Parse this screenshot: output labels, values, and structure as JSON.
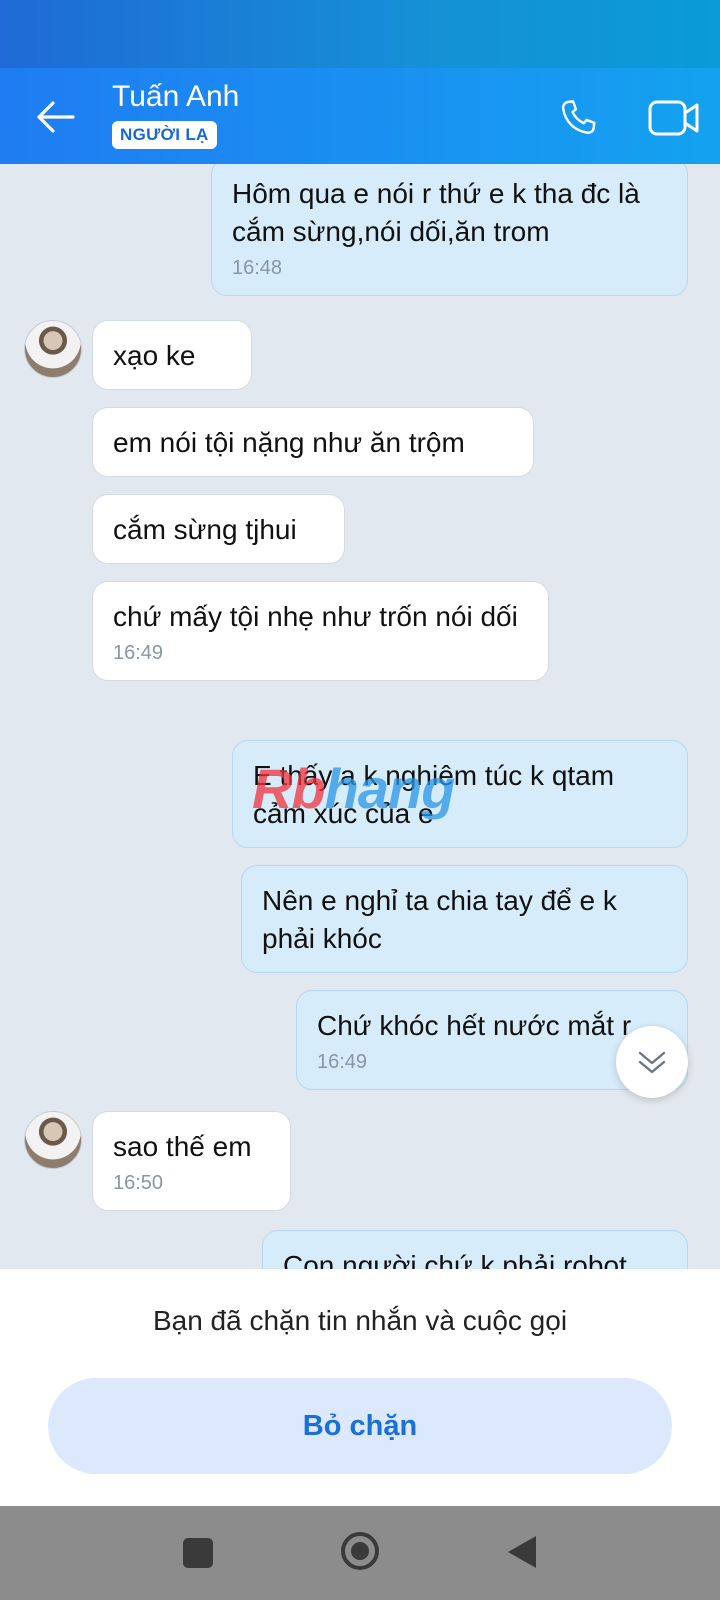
{
  "header": {
    "contact_name": "Tuấn Anh",
    "badge": "NGƯỜI LẠ"
  },
  "messages": [
    {
      "dir": "out",
      "text": "Hôm qua e nói r thứ e k tha đc là cắm sừng,nói dối,ăn trom",
      "time": "16:48"
    },
    {
      "dir": "in",
      "text": "xạo ke",
      "time": ""
    },
    {
      "dir": "in",
      "text": "em nói tội nặng như ăn trộm",
      "time": ""
    },
    {
      "dir": "in",
      "text": "cắm sừng tjhui",
      "time": ""
    },
    {
      "dir": "in",
      "text": "chứ mấy tội nhẹ như trốn nói dối",
      "time": "16:49"
    },
    {
      "dir": "out",
      "text": "E thấy a k nghiêm túc k qtam cảm xúc của e",
      "time": ""
    },
    {
      "dir": "out",
      "text": "Nên e nghỉ ta chia tay để e k phải khóc",
      "time": ""
    },
    {
      "dir": "out",
      "text": "Chứ khóc hết nước mắt r",
      "time": "16:49"
    },
    {
      "dir": "in",
      "text": "sao thế em",
      "time": "16:50"
    },
    {
      "dir": "out",
      "text": "Con người chứ k phải robot",
      "time": ""
    }
  ],
  "watermark": {
    "part1": "Rb",
    "part2": "hang"
  },
  "block_panel": {
    "message": "Bạn đã chặn tin nhắn và cuộc gọi",
    "unblock_label": "Bỏ chặn"
  },
  "colors": {
    "header_start": "#1f7cf2",
    "header_end": "#14a2f0",
    "outgoing_bubble": "#d6ecfb",
    "incoming_bubble": "#ffffff",
    "accent": "#1c6fd6"
  }
}
